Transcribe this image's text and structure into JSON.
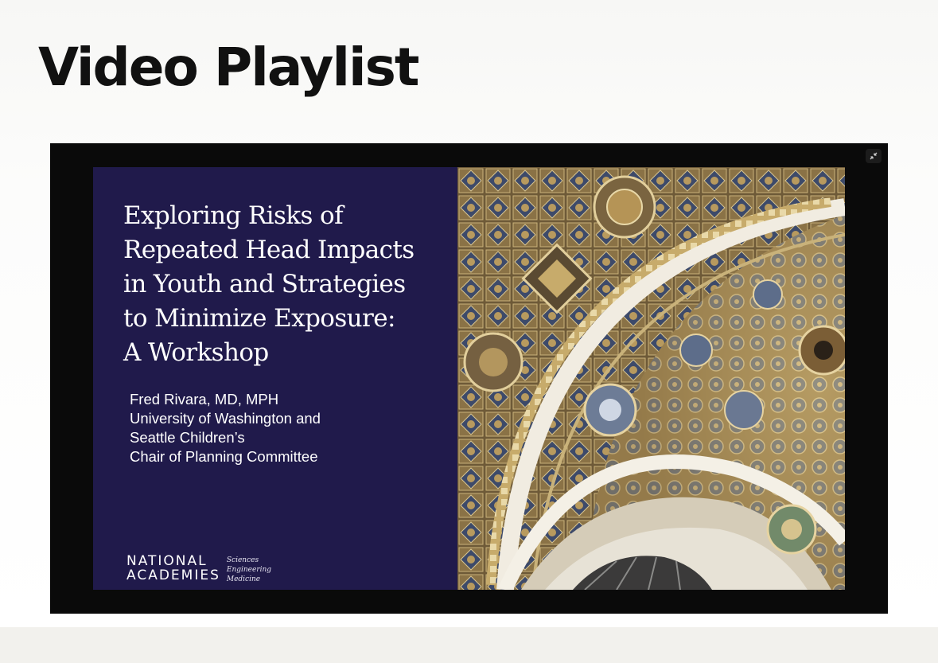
{
  "page": {
    "title": "Video Playlist"
  },
  "player": {
    "collapse_icon": "collapse-arrows-icon",
    "slide": {
      "title_lines": [
        "Exploring Risks of",
        "Repeated Head Impacts",
        "in Youth and Strategies",
        "to Minimize Exposure:",
        "A Workshop"
      ],
      "presenter_lines": [
        "Fred Rivara, MD, MPH",
        "University of Washington and",
        "Seattle Children’s",
        "Chair of Planning Committee"
      ],
      "logo": {
        "line1": "NATIONAL",
        "line2": "ACADEMIES",
        "sub": [
          "Sciences",
          "Engineering",
          "Medicine"
        ]
      },
      "image": "ornate-ceiling-dome"
    }
  },
  "colors": {
    "slide_bg": "#201a4b",
    "player_bg": "#0a0a0a",
    "page_footer": "#f2f1ed"
  }
}
